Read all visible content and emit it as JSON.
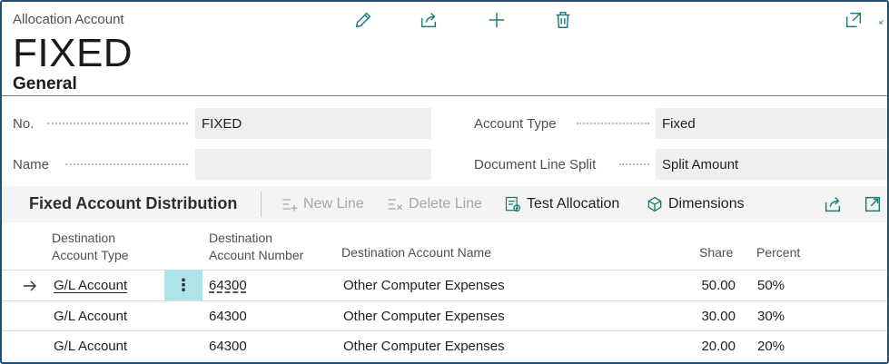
{
  "header": {
    "caption": "Allocation Account",
    "title": "FIXED",
    "section": "General",
    "icons": [
      "edit-icon",
      "share-icon",
      "new-icon",
      "delete-icon",
      "open-new-window-icon",
      "collapse-icon"
    ]
  },
  "general": {
    "no_label": "No.",
    "no_value": "FIXED",
    "name_label": "Name",
    "name_value": "",
    "account_type_label": "Account Type",
    "account_type_value": "Fixed",
    "split_label": "Document Line Split",
    "split_value": "Split Amount"
  },
  "lines": {
    "title": "Fixed Account Distribution",
    "actions": {
      "new_line": "New Line",
      "delete_line": "Delete Line",
      "test_allocation": "Test Allocation",
      "dimensions": "Dimensions"
    },
    "columns": {
      "dest_type": [
        "Destination",
        "Account Type"
      ],
      "dest_number": [
        "Destination",
        "Account Number"
      ],
      "dest_name": "Destination Account Name",
      "share": "Share",
      "percent": "Percent"
    },
    "rows": [
      {
        "type": "G/L Account",
        "number": "64300",
        "name": "Other Computer Expenses",
        "share": "50.00",
        "percent": "50%"
      },
      {
        "type": "G/L Account",
        "number": "64300",
        "name": "Other Computer Expenses",
        "share": "30.00",
        "percent": "30%"
      },
      {
        "type": "G/L Account",
        "number": "64300",
        "name": "Other Computer Expenses",
        "share": "20.00",
        "percent": "20%"
      }
    ]
  },
  "colors": {
    "accent": "#1f7a7a",
    "frame": "#1f4e79",
    "selected_cell": "#aee3ea"
  }
}
